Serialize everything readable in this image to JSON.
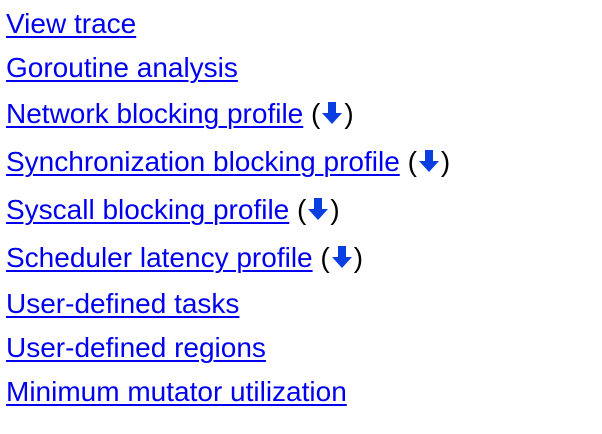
{
  "links": [
    {
      "label": "View trace",
      "has_download": false
    },
    {
      "label": "Goroutine analysis",
      "has_download": false
    },
    {
      "label": "Network blocking profile",
      "has_download": true
    },
    {
      "label": "Synchronization blocking profile",
      "has_download": true
    },
    {
      "label": "Syscall blocking profile",
      "has_download": true
    },
    {
      "label": "Scheduler latency profile",
      "has_download": true
    },
    {
      "label": "User-defined tasks",
      "has_download": false
    },
    {
      "label": "User-defined regions",
      "has_download": false
    },
    {
      "label": "Minimum mutator utilization",
      "has_download": false
    }
  ],
  "download": {
    "open_paren": "(",
    "close_paren": ")",
    "icon": "down-arrow-icon"
  },
  "colors": {
    "link": "#0000ee",
    "text": "#000000",
    "background": "#ffffff"
  }
}
